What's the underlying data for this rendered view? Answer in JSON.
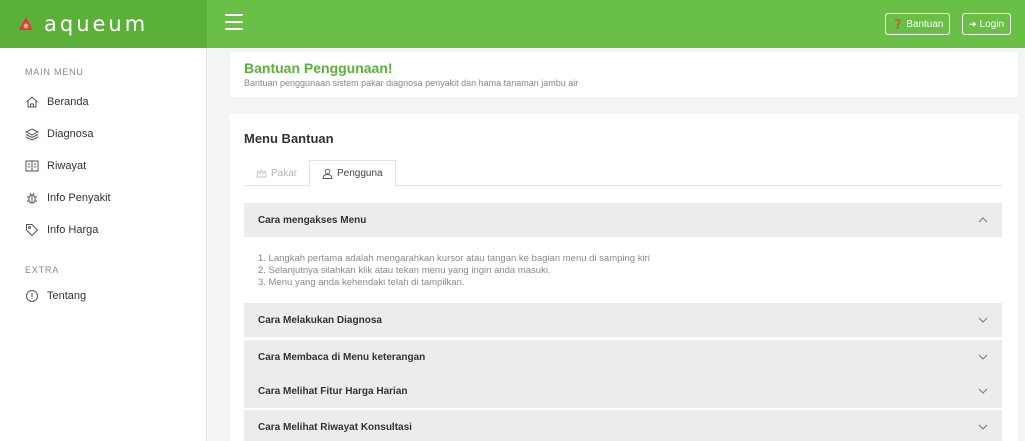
{
  "brand": {
    "name": "aqueum"
  },
  "topbar": {
    "help_label": "Bantuan",
    "login_label": "Login"
  },
  "sidebar": {
    "main_section": "MAIN MENU",
    "extra_section": "EXTRA",
    "items": [
      {
        "label": "Beranda",
        "icon": "home-icon"
      },
      {
        "label": "Diagnosa",
        "icon": "layers-icon"
      },
      {
        "label": "Riwayat",
        "icon": "book-icon"
      },
      {
        "label": "Info Penyakit",
        "icon": "bug-icon"
      },
      {
        "label": "Info Harga",
        "icon": "tag-icon"
      }
    ],
    "extra_items": [
      {
        "label": "Tentang",
        "icon": "info-icon"
      }
    ]
  },
  "header": {
    "title": "Bantuan Penggunaan!",
    "subtitle": "Bantuan penggunaan sistem pakar diagnosa penyakit dan hama tanaman jambu air"
  },
  "main": {
    "title": "Menu Bantuan",
    "tabs": [
      {
        "label": "Pakar",
        "active": false
      },
      {
        "label": "Pengguna",
        "active": true
      }
    ],
    "accordion": [
      {
        "title": "Cara mengakses Menu",
        "expanded": true,
        "lines": [
          "1. Langkah pertama adalah mengarahkan kursor atau tangan ke bagian menu di samping kiri",
          "2. Selanjutnya silahkan klik atau tekan menu yang ingin anda masuki.",
          "3. Menu yang anda kehendaki telah di tampilkan."
        ]
      },
      {
        "title": "Cara Melakukan Diagnosa",
        "expanded": false
      },
      {
        "title": "Cara Membaca di Menu keterangan",
        "expanded": false
      },
      {
        "title": "Cara Melihat Fitur Harga Harian",
        "expanded": false
      },
      {
        "title": "Cara Melihat Riwayat Konsultasi",
        "expanded": false
      }
    ]
  },
  "colors": {
    "brand_green": "#5bb03a",
    "topbar_green": "#6abf47",
    "logo_red": "#e53935"
  }
}
